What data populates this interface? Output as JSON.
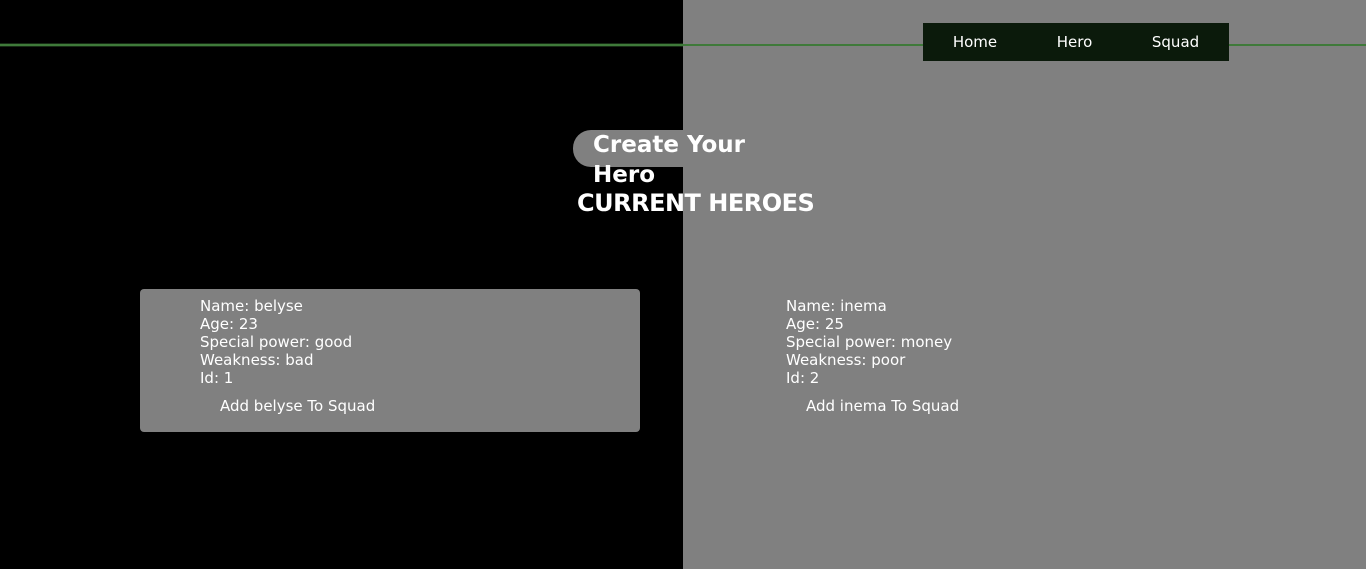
{
  "nav": {
    "items": [
      {
        "label": "Home"
      },
      {
        "label": "Hero"
      },
      {
        "label": "Squad"
      }
    ]
  },
  "main": {
    "create_label": "Create Your Hero",
    "heroes_title": "CURRENT HEROES"
  },
  "heroes": [
    {
      "name": "Name: belyse",
      "age": "Age: 23",
      "power": "Special power: good",
      "weakness": "Weakness: bad",
      "id": "Id: 1",
      "add_label": "Add belyse To Squad"
    },
    {
      "name": "Name: inema",
      "age": "Age: 25",
      "power": "Special power: money",
      "weakness": "Weakness: poor",
      "id": "Id: 2",
      "add_label": "Add inema To Squad"
    }
  ],
  "colors": {
    "left_background": "#000000",
    "right_background": "#808080",
    "nav_background": "#0b1a0b",
    "accent_line": "#3f7a3a",
    "text": "#ffffff"
  }
}
